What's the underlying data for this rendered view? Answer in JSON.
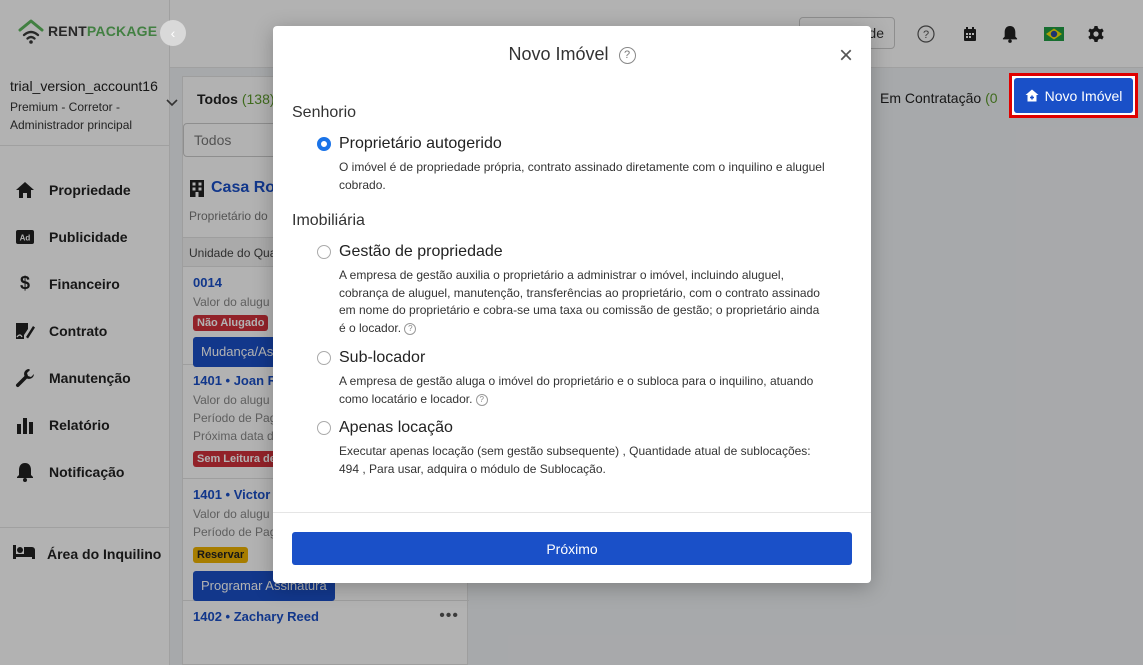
{
  "app": {
    "logo_rent": "RENT",
    "logo_package": "PACKAGE",
    "brand_color": "#5fb85f",
    "accent_color": "#1a50c8"
  },
  "account": {
    "name": "trial_version_account16",
    "role_line1": "Premium - Corretor -",
    "role_line2": "Administrador principal"
  },
  "nav": {
    "items": [
      {
        "label": "Propriedade",
        "icon": "home-icon"
      },
      {
        "label": "Publicidade",
        "icon": "ad-icon"
      },
      {
        "label": "Financeiro",
        "icon": "dollar-icon"
      },
      {
        "label": "Contrato",
        "icon": "contract-icon"
      },
      {
        "label": "Manutenção",
        "icon": "wrench-icon"
      },
      {
        "label": "Relatório",
        "icon": "bar-chart-icon"
      },
      {
        "label": "Notificação",
        "icon": "bell-icon"
      }
    ],
    "tenant_area": "Área do Inquilino"
  },
  "header": {
    "upgrade_label": "de"
  },
  "tabs": {
    "todos_label": "Todos",
    "todos_count": "(138)",
    "contratacao_label": "Em Contratação",
    "contratacao_count": "(0"
  },
  "new_property_button": "Novo Imóvel",
  "filter": {
    "value": "Todos"
  },
  "property": {
    "title": "Casa Rou",
    "subtitle": "Proprietário do",
    "unit_header": "Unidade do Qua"
  },
  "units": [
    {
      "id": "0014",
      "line1": "Valor do alugu",
      "badge": "Não Alugado",
      "button": "Mudança/Ass"
    },
    {
      "id": "1401 • Joan R",
      "line1": "Valor do alugu",
      "line2": "Período de Pag",
      "line3": "Próxima data d",
      "badge": "Sem Leitura de"
    },
    {
      "id": "1401 • Victor",
      "line1": "Valor do alugu",
      "line2": "Período de Pag",
      "badge": "Reservar",
      "button": "Programar Assinatura"
    },
    {
      "id": "1402 • Zachary Reed",
      "dots": "•••"
    }
  ],
  "modal": {
    "title": "Novo Imóvel",
    "help": "?",
    "close": "×",
    "section_landlord": "Senhorio",
    "section_agency": "Imobiliária",
    "options": [
      {
        "label": "Proprietário autogerido",
        "selected": true,
        "desc": "O imóvel é de propriedade própria, contrato assinado diretamente com o inquilino e aluguel cobrado."
      },
      {
        "label": "Gestão de propriedade",
        "selected": false,
        "desc": "A empresa de gestão auxilia o proprietário a administrar o imóvel, incluindo aluguel, cobrança de aluguel, manutenção, transferências ao proprietário, com o contrato assinado em nome do proprietário e cobra-se uma taxa ou comissão de gestão; o proprietário ainda é o locador."
      },
      {
        "label": "Sub-locador",
        "selected": false,
        "desc": "A empresa de gestão aluga o imóvel do proprietário e o subloca para o inquilino, atuando como locatário e locador."
      },
      {
        "label": "Apenas locação",
        "selected": false,
        "desc": "Executar apenas locação (sem gestão subsequente) , Quantidade atual de sublocações: 494 , Para usar, adquira o módulo de Sublocação."
      }
    ],
    "next_button": "Próximo"
  }
}
